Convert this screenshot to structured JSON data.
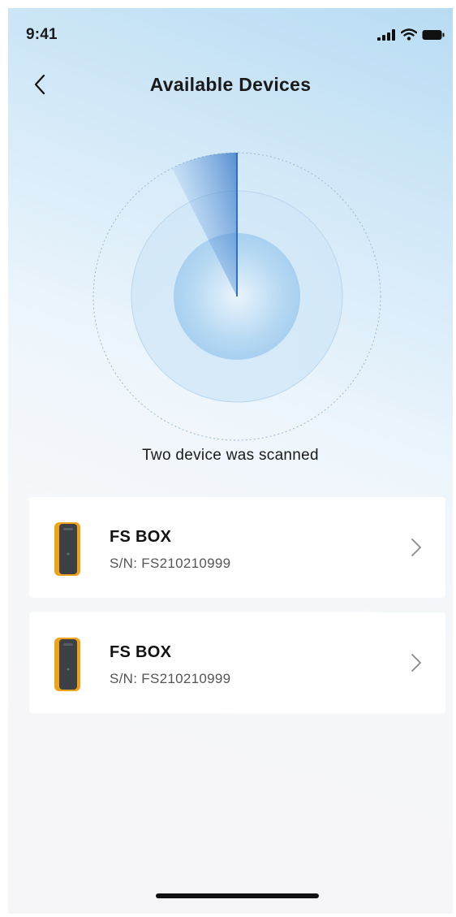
{
  "status_bar": {
    "time": "9:41",
    "icons": [
      "signal-icon",
      "wifi-icon",
      "battery-icon"
    ]
  },
  "header": {
    "back_icon": "chevron-left-icon",
    "title": "Available Devices"
  },
  "scanner": {
    "status_text": "Two device was scanned"
  },
  "devices": [
    {
      "name": "FS BOX",
      "serial": "S/N: FS210210999",
      "icon": "device-box-icon"
    },
    {
      "name": "FS BOX",
      "serial": "S/N: FS210210999",
      "icon": "device-box-icon"
    }
  ],
  "colors": {
    "accent": "#2f6fc4",
    "radar_light": "#cfe6f8",
    "device_orange": "#f0a21b",
    "device_body": "#3d4045"
  }
}
